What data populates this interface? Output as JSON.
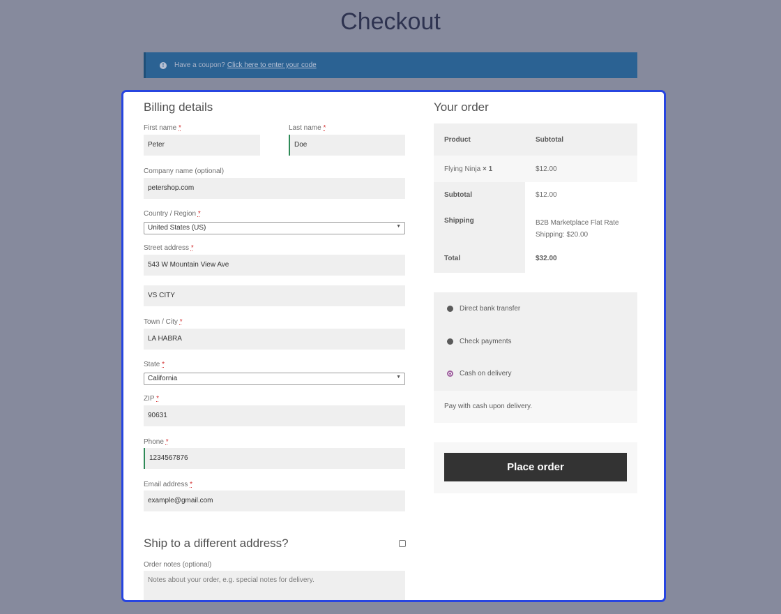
{
  "page": {
    "title": "Checkout"
  },
  "coupon": {
    "text": "Have a coupon?",
    "link": "Click here to enter your code"
  },
  "billing": {
    "heading": "Billing details",
    "required_mark": "*",
    "first_name": {
      "label": "First name",
      "value": "Peter"
    },
    "last_name": {
      "label": "Last name",
      "value": "Doe"
    },
    "company": {
      "label": "Company name (optional)",
      "value": "petershop.com"
    },
    "country": {
      "label": "Country / Region",
      "value": "United States (US)"
    },
    "street": {
      "label": "Street address",
      "value": "543 W Mountain View Ave",
      "value2": "VS CITY"
    },
    "city": {
      "label": "Town / City",
      "value": "LA HABRA"
    },
    "state": {
      "label": "State",
      "value": "California"
    },
    "zip": {
      "label": "ZIP",
      "value": "90631"
    },
    "phone": {
      "label": "Phone",
      "value": "1234567876"
    },
    "email": {
      "label": "Email address",
      "value": "example@gmail.com"
    },
    "ship_different": "Ship to a different address?",
    "notes": {
      "label": "Order notes (optional)",
      "placeholder": "Notes about your order, e.g. special notes for delivery."
    }
  },
  "order": {
    "heading": "Your order",
    "col_product": "Product",
    "col_subtotal": "Subtotal",
    "item_name": "Flying Ninja",
    "item_qty": "× 1",
    "item_price": "$12.00",
    "subtotal_label": "Subtotal",
    "subtotal_value": "$12.00",
    "shipping_label": "Shipping",
    "shipping_value": "B2B Marketplace Flat Rate Shipping: $20.00",
    "total_label": "Total",
    "total_value": "$32.00"
  },
  "payment": {
    "options": [
      "Direct bank transfer",
      "Check payments",
      "Cash on delivery"
    ],
    "selected": "Cash on delivery",
    "description": "Pay with cash upon delivery.",
    "radio_color": "#9e5f9e"
  },
  "place_order": {
    "label": "Place order",
    "color": "#333333"
  },
  "colors": {
    "background": "#868a9d",
    "coupon_bar": "#2b6293",
    "modal_border": "#2745e0"
  }
}
